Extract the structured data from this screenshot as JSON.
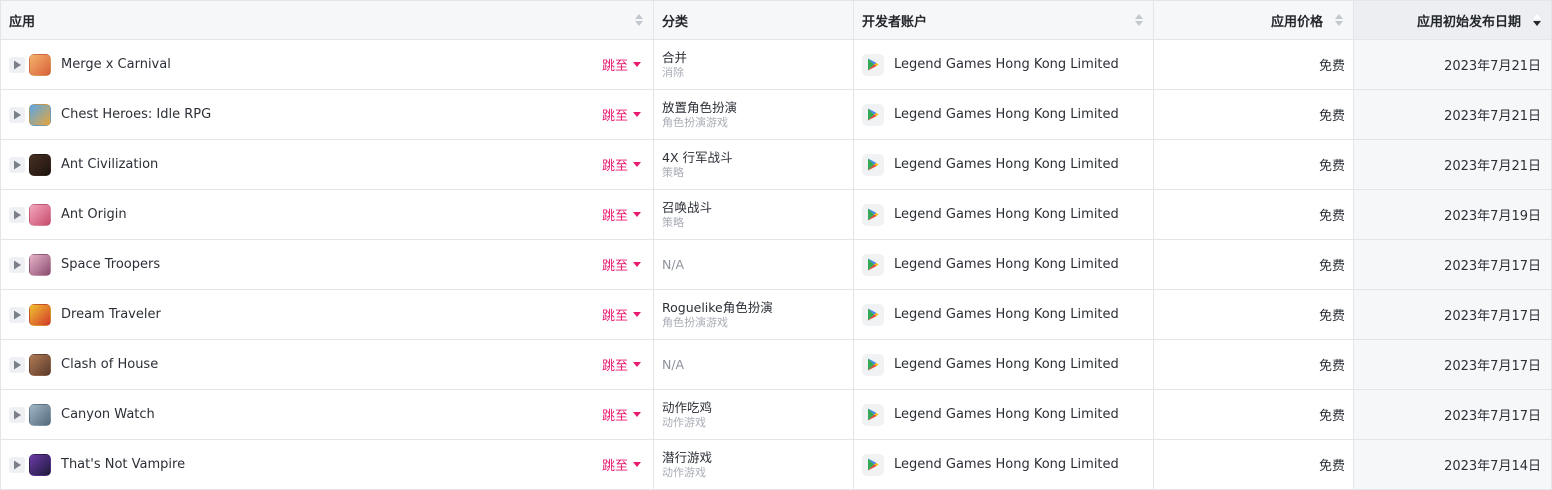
{
  "columns": {
    "app": "应用",
    "category": "分类",
    "developer": "开发者账户",
    "price": "应用价格",
    "release_date": "应用初始发布日期"
  },
  "jump_label": "跳至",
  "accent_color": "#e8196f",
  "rows": [
    {
      "name": "Merge x Carnival",
      "cat_main": "合并",
      "cat_sub": "消除",
      "developer": "Legend Games Hong Kong Limited",
      "price": "免费",
      "date": "2023年7月21日",
      "icon_colors": [
        "#f4b36b",
        "#d9603b"
      ]
    },
    {
      "name": "Chest Heroes: Idle RPG",
      "cat_main": "放置角色扮演",
      "cat_sub": "角色扮演游戏",
      "developer": "Legend Games Hong Kong Limited",
      "price": "免费",
      "date": "2023年7月21日",
      "icon_colors": [
        "#5aa7e8",
        "#e6a53a"
      ]
    },
    {
      "name": "Ant Civilization",
      "cat_main": "4X 行军战斗",
      "cat_sub": "策略",
      "developer": "Legend Games Hong Kong Limited",
      "price": "免费",
      "date": "2023年7月21日",
      "icon_colors": [
        "#4a2f22",
        "#1b1410"
      ]
    },
    {
      "name": "Ant Origin",
      "cat_main": "召唤战斗",
      "cat_sub": "策略",
      "developer": "Legend Games Hong Kong Limited",
      "price": "免费",
      "date": "2023年7月19日",
      "icon_colors": [
        "#f2a7c0",
        "#c94c6a"
      ]
    },
    {
      "name": "Space Troopers",
      "cat_main": "N/A",
      "cat_sub": "",
      "developer": "Legend Games Hong Kong Limited",
      "price": "免费",
      "date": "2023年7月17日",
      "icon_colors": [
        "#e7b3c8",
        "#8a4b6f"
      ]
    },
    {
      "name": "Dream Traveler",
      "cat_main": "Roguelike角色扮演",
      "cat_sub": "角色扮演游戏",
      "developer": "Legend Games Hong Kong Limited",
      "price": "免费",
      "date": "2023年7月17日",
      "icon_colors": [
        "#f0c030",
        "#d23a2a"
      ]
    },
    {
      "name": "Clash of House",
      "cat_main": "N/A",
      "cat_sub": "",
      "developer": "Legend Games Hong Kong Limited",
      "price": "免费",
      "date": "2023年7月17日",
      "icon_colors": [
        "#b07a55",
        "#5a3a2a"
      ]
    },
    {
      "name": "Canyon Watch",
      "cat_main": "动作吃鸡",
      "cat_sub": "动作游戏",
      "developer": "Legend Games Hong Kong Limited",
      "price": "免费",
      "date": "2023年7月17日",
      "icon_colors": [
        "#9fb6c8",
        "#556a7a"
      ]
    },
    {
      "name": "That's Not Vampire",
      "cat_main": "潜行游戏",
      "cat_sub": "动作游戏",
      "developer": "Legend Games Hong Kong Limited",
      "price": "免费",
      "date": "2023年7月14日",
      "icon_colors": [
        "#6b3aa8",
        "#1f1a3a"
      ]
    }
  ]
}
